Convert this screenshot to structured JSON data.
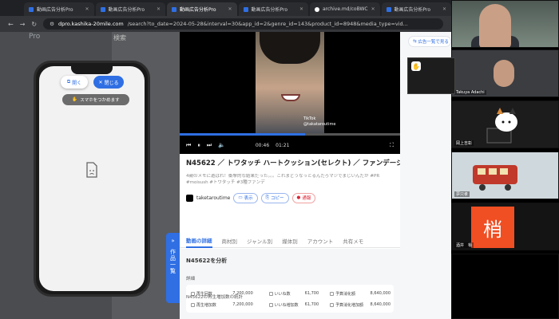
{
  "browser": {
    "tabs": [
      {
        "label": "動画広告分析Pro",
        "active": false
      },
      {
        "label": "動画広告分析Pro",
        "active": false
      },
      {
        "label": "動画広告分析Pro",
        "active": true
      },
      {
        "label": "動画広告分析Pro",
        "active": false
      },
      {
        "label": "archive.md/coBWC",
        "active": false
      },
      {
        "label": "動画広告分析Pro",
        "active": false
      }
    ],
    "url_host": "dpro.kashika-20mile.com",
    "url_rest": "/search?to_date=2024-05-28&interval=30&app_id=2&genre_id=143&product_id=8948&media_type=vid..."
  },
  "app": {
    "brand": "Pro",
    "search_label": "検索",
    "open_label": "開く",
    "close_label": "閉じる",
    "drag_hint": "スマホをつかめます",
    "side_tab_label": "作品一覧"
  },
  "video": {
    "current_time": "00:46",
    "duration": "01:21",
    "progress": 0.57,
    "watermark_top": "TikTok",
    "watermark_user": "@takataroutime"
  },
  "detail": {
    "title": "N45622 ／ トワタッチ ハートクッション(セレクト) ／ ファンデーション",
    "description": "4親のメモに遊ばれ！衝撃的な結果だった。。。これまどうなっとるんだろマジでまじいんだが #PR #moisush #トワタッチ #3種ファンデ",
    "username": "taketaroutime",
    "buttons": {
      "show": "表示",
      "copy": "コピー",
      "report": "通報"
    },
    "tabs": [
      "動画の詳細",
      "商材別",
      "ジャンル別",
      "媒体別",
      "アカウント",
      "共有メモ"
    ],
    "analyze_heading": "N45622を分析",
    "detail_heading": "詳細",
    "stats_heading": "N45622の再生増加数の統計",
    "rows": [
      {
        "l1": "再生回数",
        "v1": "7,200,000",
        "l2": "いいね数",
        "v2": "61,700",
        "l3": "予算消化額",
        "v3": "8,640,000"
      },
      {
        "l1": "再生増加数",
        "v1": "7,200,000",
        "l2": "いいね増加数",
        "v2": "61,700",
        "l3": "予算消化増加額",
        "v3": "8,640,000"
      }
    ]
  },
  "rightpane": {
    "back_link": "広告一覧で見る"
  },
  "call": {
    "participants": [
      {
        "name": ""
      },
      {
        "name": "Takuya Adachi"
      },
      {
        "name": "岡上吉彰"
      },
      {
        "name": "夢只孝"
      },
      {
        "name": "酒井　梢"
      },
      {
        "name": ""
      }
    ],
    "kanji": "梢"
  }
}
